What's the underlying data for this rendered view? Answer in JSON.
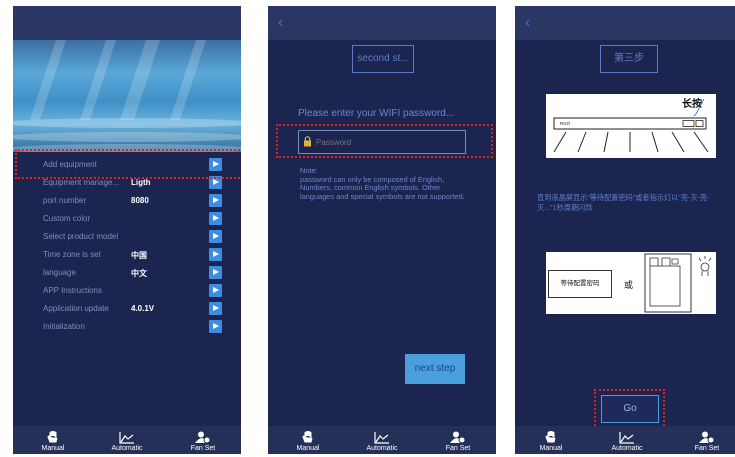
{
  "screen1": {
    "menu": [
      {
        "label": "Add equipment",
        "value": ""
      },
      {
        "label": "Equipment manage...",
        "value": "Ligth"
      },
      {
        "label": "port number",
        "value": "8080"
      },
      {
        "label": "Custom color",
        "value": ""
      },
      {
        "label": "Select product model",
        "value": ""
      },
      {
        "label": "Time zone is set",
        "value": "中国"
      },
      {
        "label": "language",
        "value": "中文"
      },
      {
        "label": "APP Instructions",
        "value": ""
      },
      {
        "label": "Application update",
        "value": "4.0.1V"
      },
      {
        "label": "Initialization",
        "value": ""
      }
    ]
  },
  "screen2": {
    "back_icon": "chevron-left-icon",
    "title": "second st...",
    "prompt": "Please enter your WIFI password...",
    "password_placeholder": "Password",
    "note": "Note:\n password can only be composed of English, Numbers, common English symbols. Other languages and special symbols are not supported.",
    "next_label": "next step"
  },
  "screen3": {
    "title": "第三步",
    "long_press": "长按",
    "device_label": "RGO",
    "instruction": "直到液晶屏显示“等待配置密码”或者指示灯以“亮-灭-亮-灭...”1秒周期闪烁",
    "waiting_text": "等待配置密码",
    "or_text": "或",
    "go_label": "Go"
  },
  "tabs": [
    {
      "label": "Manual",
      "icon": "hand-icon"
    },
    {
      "label": "Automatic",
      "icon": "line-chart-icon"
    },
    {
      "label": "Fan Set",
      "icon": "user-settings-icon"
    }
  ],
  "colors": {
    "background": "#1c2550",
    "accent": "#3d8ee0",
    "highlight": "#e0201a",
    "button": "#4aa0dc"
  }
}
